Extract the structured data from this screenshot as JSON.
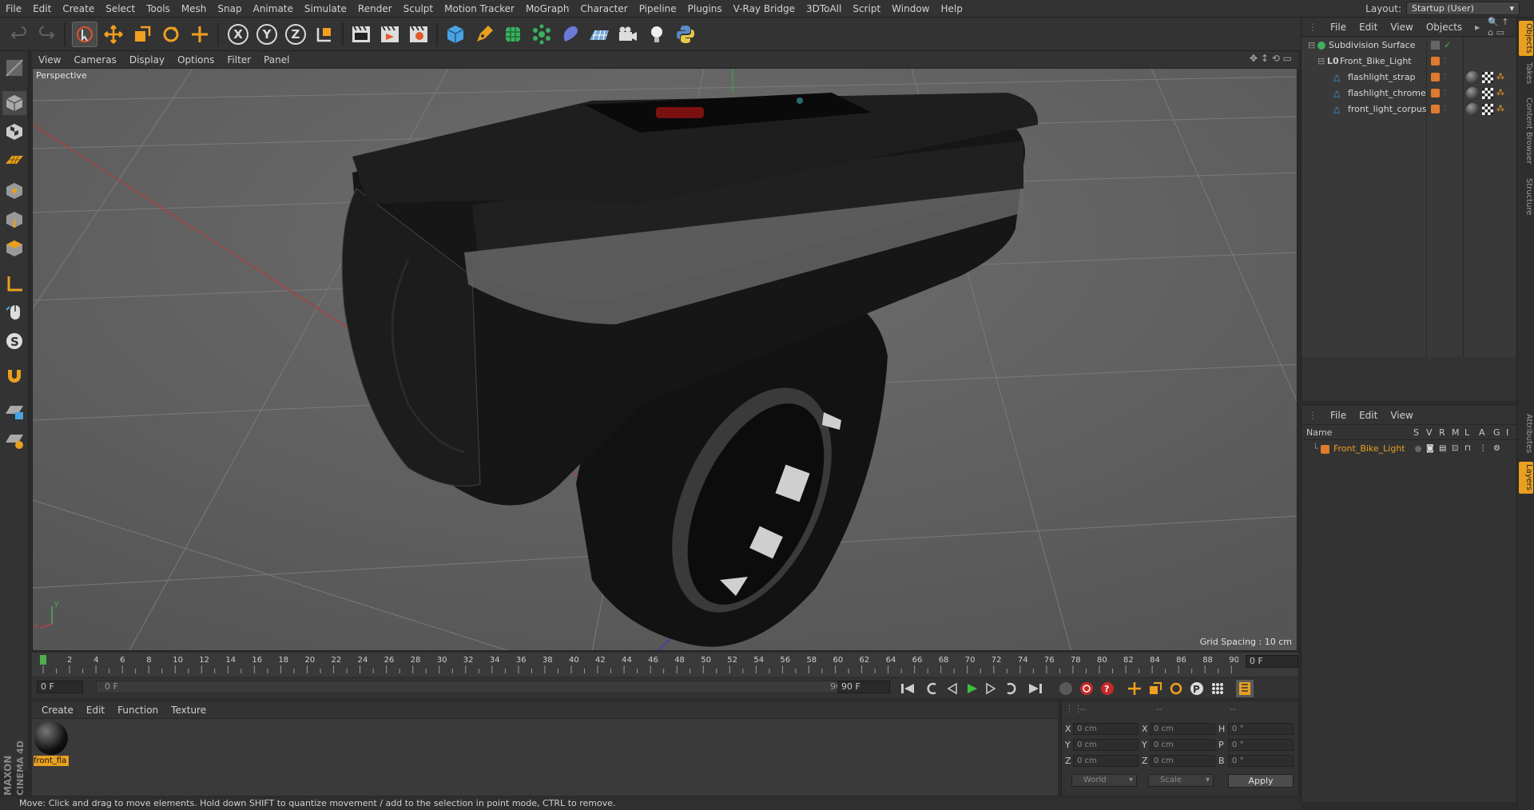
{
  "menubar": {
    "items": [
      "File",
      "Edit",
      "Create",
      "Select",
      "Tools",
      "Mesh",
      "Snap",
      "Animate",
      "Simulate",
      "Render",
      "Sculpt",
      "Motion Tracker",
      "MoGraph",
      "Character",
      "Pipeline",
      "Plugins",
      "V-Ray Bridge",
      "3DToAll",
      "Script",
      "Window",
      "Help"
    ],
    "layout_label": "Layout:",
    "layout_value": "Startup (User)"
  },
  "toolbar": {
    "icons": [
      "undo-icon",
      "redo-icon",
      "live-selection-icon",
      "move-icon",
      "scale-icon",
      "rotate-icon",
      "add-icon",
      "x-axis-icon",
      "y-axis-icon",
      "z-axis-icon",
      "coordinate-system-icon",
      "render-view-icon",
      "render-picture-viewer-icon",
      "render-settings-icon",
      "cube-icon",
      "pen-icon",
      "subdivision-icon",
      "array-icon",
      "deformer-icon",
      "floor-icon",
      "camera-icon",
      "light-icon",
      "python-icon"
    ],
    "axis_x": "X",
    "axis_y": "Y",
    "axis_z": "Z"
  },
  "viewport": {
    "menu": [
      "View",
      "Cameras",
      "Display",
      "Options",
      "Filter",
      "Panel"
    ],
    "label": "Perspective",
    "grid_spacing": "Grid Spacing : 10 cm",
    "colors": {
      "bg": "#5d5d5d",
      "grid": "#777777",
      "x_axis": "#b43a3a",
      "y_axis": "#3aa83a"
    }
  },
  "timeline": {
    "ticks": [
      "0",
      "2",
      "4",
      "6",
      "8",
      "10",
      "12",
      "14",
      "16",
      "18",
      "20",
      "22",
      "24",
      "26",
      "28",
      "30",
      "32",
      "34",
      "36",
      "38",
      "40",
      "42",
      "44",
      "46",
      "48",
      "50",
      "52",
      "54",
      "56",
      "58",
      "60",
      "62",
      "64",
      "66",
      "68",
      "70",
      "72",
      "74",
      "76",
      "78",
      "80",
      "82",
      "84",
      "86",
      "88",
      "90"
    ],
    "current_frame": "0 F"
  },
  "transport": {
    "start_field": "0 F",
    "slider_start": "0 F",
    "slider_end": "90 F",
    "end_field": "90 F"
  },
  "material_manager": {
    "menu": [
      "Create",
      "Edit",
      "Function",
      "Texture"
    ],
    "materials": [
      {
        "name": "front_fla"
      }
    ]
  },
  "coordinates": {
    "header": [
      "--",
      "--",
      "--"
    ],
    "rows": [
      {
        "a": "X",
        "av": "0 cm",
        "b": "X",
        "bv": "0 cm",
        "c": "H",
        "cv": "0 °"
      },
      {
        "a": "Y",
        "av": "0 cm",
        "b": "Y",
        "bv": "0 cm",
        "c": "P",
        "cv": "0 °"
      },
      {
        "a": "Z",
        "av": "0 cm",
        "b": "Z",
        "bv": "0 cm",
        "c": "B",
        "cv": "0 °"
      }
    ],
    "mode": "World",
    "scale": "Scale",
    "apply": "Apply"
  },
  "status_bar": "Move: Click and drag to move elements. Hold down SHIFT to quantize movement / add to the selection in point mode, CTRL to remove.",
  "object_manager": {
    "menu": [
      "File",
      "Edit",
      "View",
      "Objects"
    ],
    "objects": [
      {
        "name": "Subdivision Surface",
        "indent": 0
      },
      {
        "name": "Front_Bike_Light",
        "indent": 1
      },
      {
        "name": "flashlight_strap",
        "indent": 2
      },
      {
        "name": "flashlight_chrome",
        "indent": 2
      },
      {
        "name": "front_light_corpus",
        "indent": 2
      }
    ]
  },
  "layer_manager": {
    "menu": [
      "File",
      "Edit",
      "View"
    ],
    "columns": [
      "Name",
      "S",
      "V",
      "R",
      "M",
      "L",
      "A",
      "G",
      "I"
    ],
    "layers": [
      {
        "name": "Front_Bike_Light",
        "color": "#e07a2e"
      }
    ]
  },
  "right_tabs": [
    "Objects",
    "Takes",
    "Content Browser",
    "Structure",
    "Attributes",
    "Layers"
  ],
  "branding": {
    "maxon": "MAXON",
    "cinema": "CINEMA 4D"
  }
}
